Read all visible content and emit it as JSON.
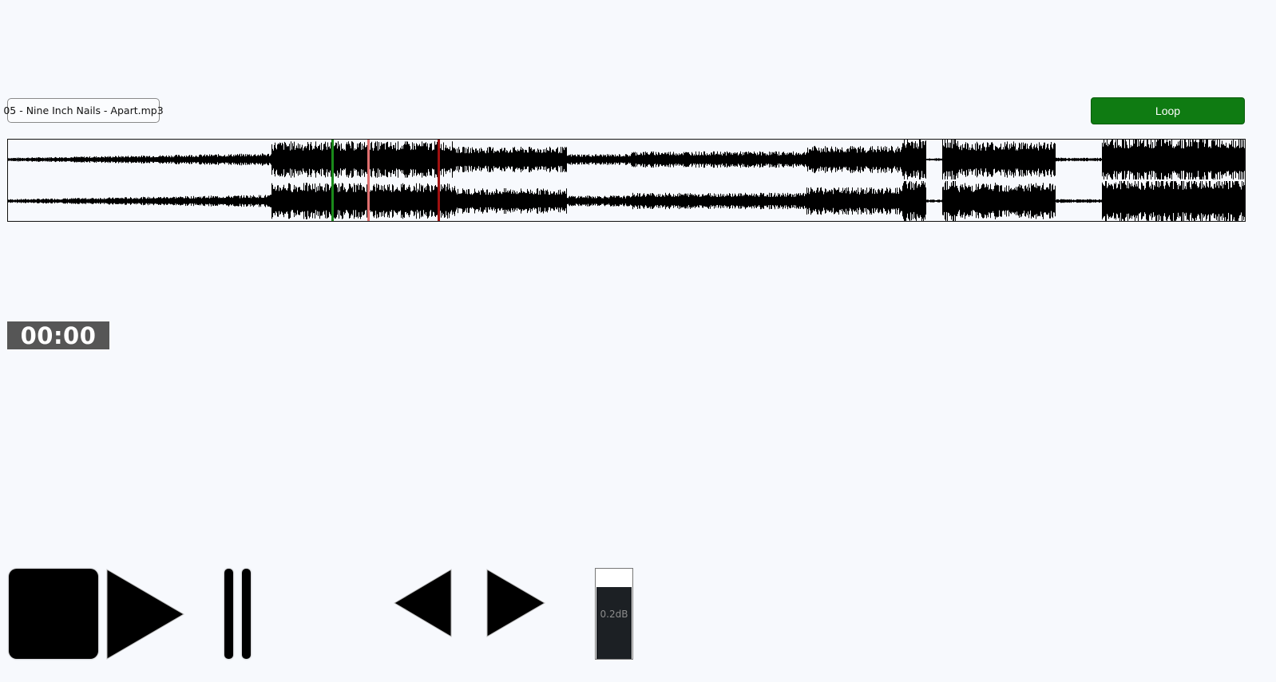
{
  "track": {
    "filename": "05 - Nine Inch Nails - Apart.mp3"
  },
  "loop_button": {
    "label": "Loop",
    "color": "#0f7b12"
  },
  "waveform": {
    "playhead_fraction": 0.262,
    "loop_start_fraction": 0.291,
    "loop_end_fraction": 0.348,
    "playhead_color": "#1a8a1a",
    "loop_start_color": "#e07070",
    "loop_end_color": "#a01010"
  },
  "time": {
    "current": "00:00"
  },
  "transport": {
    "stop": "stop-icon",
    "play": "play-icon",
    "pause": "pause-icon",
    "prev": "previous-icon",
    "next": "next-icon"
  },
  "volume": {
    "label": "0.2dB",
    "level_fraction": 0.8
  }
}
